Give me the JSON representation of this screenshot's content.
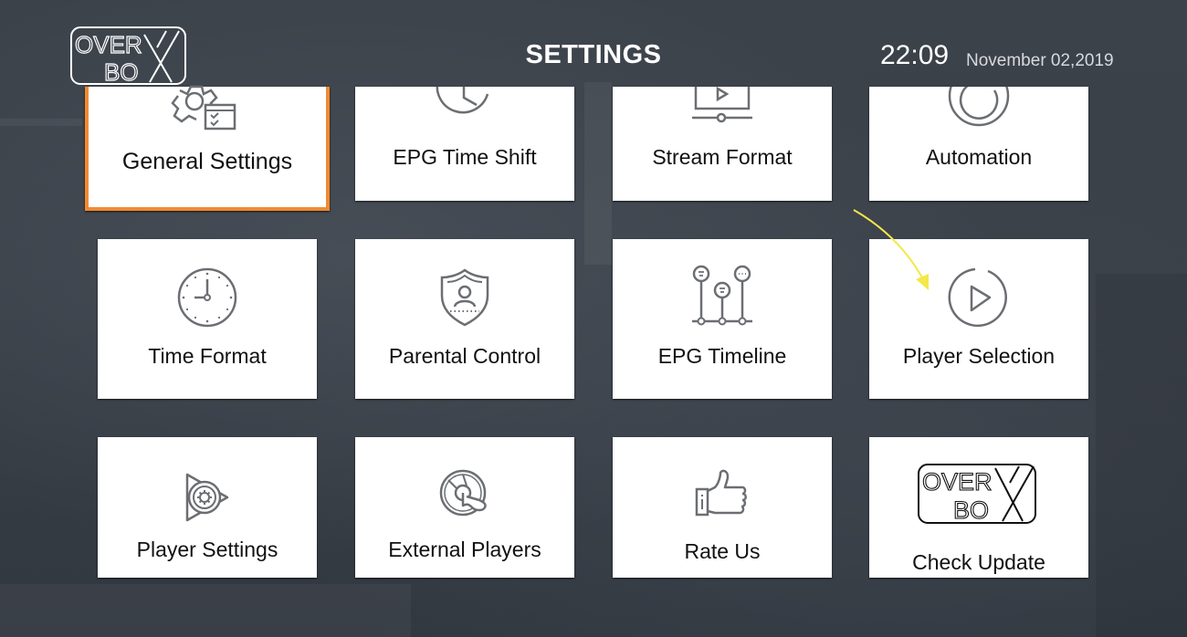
{
  "header": {
    "logo_text_top": "OVER",
    "logo_text_bottom": "BO",
    "logo_letter": "X",
    "title": "SETTINGS",
    "time": "22:09",
    "date": "November 02,2019"
  },
  "colors": {
    "focus_border": "#f08a32",
    "card_bg": "#ffffff",
    "icon_stroke": "#6b6e72",
    "annotation_arrow": "#f3e84a"
  },
  "tiles": [
    {
      "label": "General Settings",
      "icon": "gear-checklist-icon",
      "focused": true
    },
    {
      "label": "EPG Time Shift",
      "icon": "clock-icon"
    },
    {
      "label": "Stream Format",
      "icon": "video-player-icon"
    },
    {
      "label": "Automation",
      "icon": "refresh-circle-icon"
    },
    {
      "label": "Time Format",
      "icon": "wall-clock-icon"
    },
    {
      "label": "Parental Control",
      "icon": "shield-user-icon"
    },
    {
      "label": "EPG Timeline",
      "icon": "timeline-icon"
    },
    {
      "label": "Player Selection",
      "icon": "play-circle-icon"
    },
    {
      "label": "Player Settings",
      "icon": "play-gear-icon"
    },
    {
      "label": "External Players",
      "icon": "disc-touch-icon"
    },
    {
      "label": "Rate Us",
      "icon": "thumbs-up-icon"
    },
    {
      "label": "Check Update",
      "icon": "overbox-logo-icon"
    }
  ]
}
